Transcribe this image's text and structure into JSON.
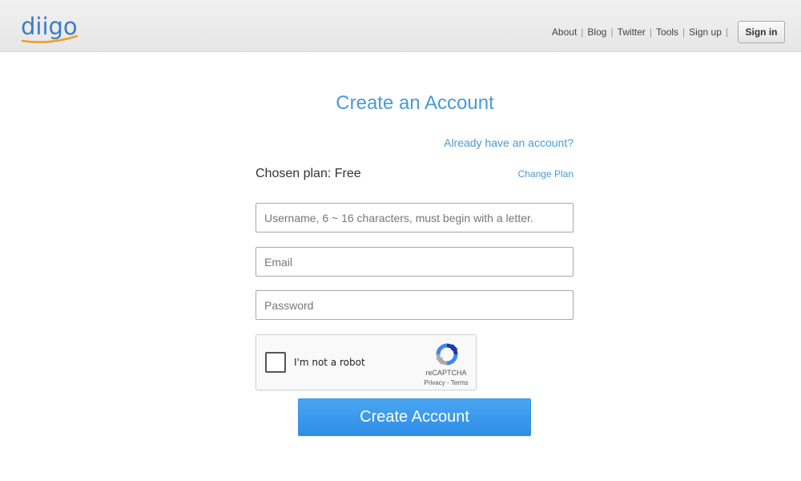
{
  "header": {
    "logo_text": "diigo",
    "nav": [
      "About",
      "Blog",
      "Twitter",
      "Tools",
      "Sign up"
    ],
    "signin_label": "Sign in"
  },
  "form": {
    "title": "Create an Account",
    "already_link": "Already have an account?",
    "chosen_plan": "Chosen plan: Free",
    "change_plan": "Change Plan",
    "username_placeholder": "Username, 6 ~ 16 characters, must begin with a letter.",
    "email_placeholder": "Email",
    "password_placeholder": "Password",
    "recaptcha": {
      "label": "I'm not a robot",
      "brand": "reCAPTCHA",
      "privacy": "Privacy",
      "terms": "Terms"
    },
    "submit_label": "Create Account"
  },
  "colors": {
    "accent": "#4a9ad6",
    "button": "#2f8de6",
    "logo_blue": "#3b7dc4",
    "logo_orange": "#f39c21"
  }
}
